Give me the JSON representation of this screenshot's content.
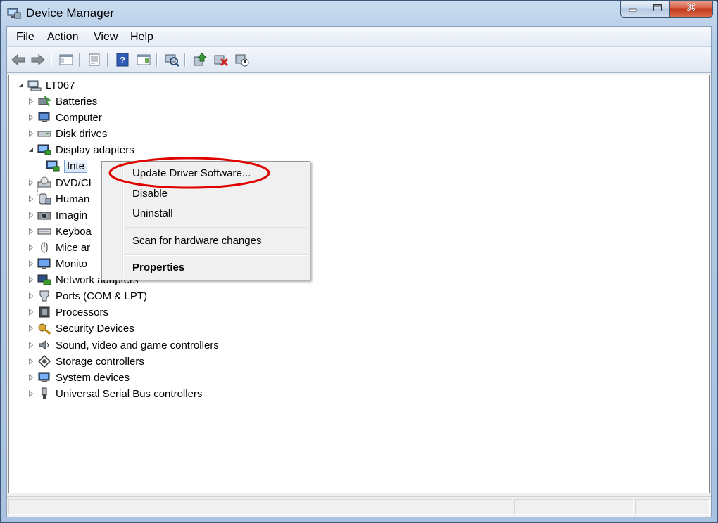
{
  "window": {
    "title": "Device Manager"
  },
  "menubar": {
    "items": [
      "File",
      "Action",
      "View",
      "Help"
    ]
  },
  "toolbar": {
    "buttons": [
      "back-icon",
      "forward-icon",
      "show-hide-console-tree-icon",
      "properties-icon",
      "help-icon",
      "show-hide-action-pane-icon",
      "scan-hardware-icon",
      "update-driver-icon",
      "uninstall-icon",
      "disable-icon"
    ]
  },
  "tree": {
    "root": "LT067",
    "items": [
      {
        "label": "Batteries",
        "icon": "battery-icon"
      },
      {
        "label": "Computer",
        "icon": "computer-icon"
      },
      {
        "label": "Disk drives",
        "icon": "disk-drive-icon"
      },
      {
        "label": "Display adapters",
        "icon": "display-adapter-icon",
        "expanded": true
      },
      {
        "label": "Inte",
        "icon": "display-adapter-icon",
        "child": true,
        "selected": true
      },
      {
        "label": "DVD/CI",
        "icon": "dvd-drive-icon"
      },
      {
        "label": "Human",
        "icon": "hid-icon"
      },
      {
        "label": "Imagin",
        "icon": "imaging-device-icon"
      },
      {
        "label": "Keyboa",
        "icon": "keyboard-icon"
      },
      {
        "label": "Mice ar",
        "icon": "mouse-icon"
      },
      {
        "label": "Monito",
        "icon": "monitor-icon"
      },
      {
        "label": "Network adapters",
        "icon": "network-adapter-icon"
      },
      {
        "label": "Ports (COM & LPT)",
        "icon": "port-icon"
      },
      {
        "label": "Processors",
        "icon": "processor-icon"
      },
      {
        "label": "Security Devices",
        "icon": "security-device-icon"
      },
      {
        "label": "Sound, video and game controllers",
        "icon": "sound-icon"
      },
      {
        "label": "Storage controllers",
        "icon": "storage-controller-icon"
      },
      {
        "label": "System devices",
        "icon": "system-device-icon"
      },
      {
        "label": "Universal Serial Bus controllers",
        "icon": "usb-icon"
      }
    ]
  },
  "context_menu": {
    "update_driver": "Update Driver Software...",
    "disable": "Disable",
    "uninstall": "Uninstall",
    "scan": "Scan for hardware changes",
    "properties": "Properties"
  },
  "colors": {
    "highlight_ellipse": "#e00000",
    "selection": "#cde0f7"
  }
}
